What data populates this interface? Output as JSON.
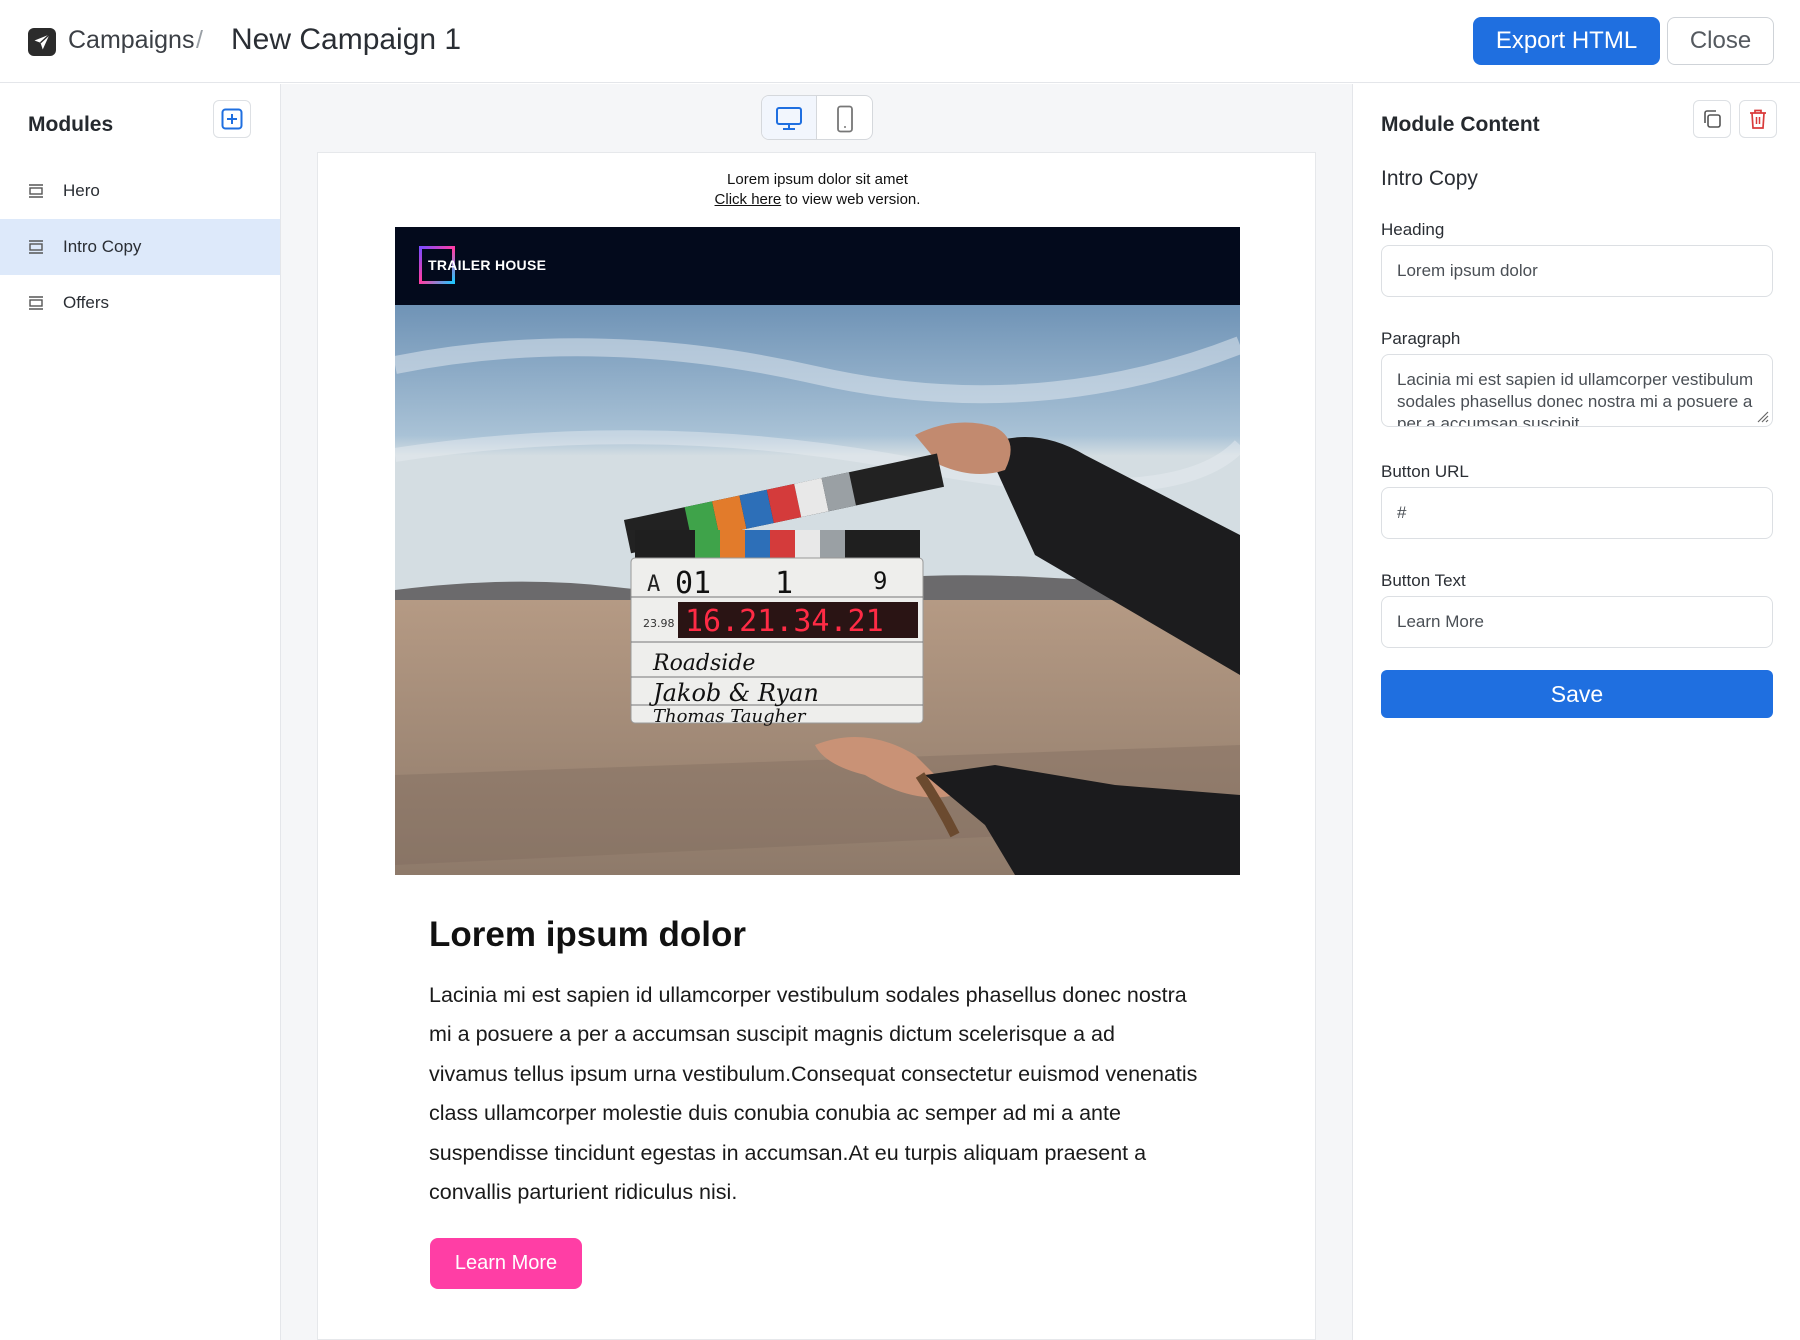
{
  "header": {
    "breadcrumb": "Campaigns",
    "separator": "/",
    "title": "New Campaign 1",
    "export_label": "Export HTML",
    "close_label": "Close"
  },
  "sidebar": {
    "title": "Modules",
    "items": [
      {
        "label": "Hero",
        "active": false
      },
      {
        "label": "Intro Copy",
        "active": true
      },
      {
        "label": "Offers",
        "active": false
      }
    ]
  },
  "email": {
    "preheader": "Lorem ipsum dolor sit amet",
    "webview_link": "Click here",
    "webview_suffix": " to view web version.",
    "brand": "TRAILER HOUSE",
    "clapper": {
      "roll": "A",
      "scene": "01",
      "shot": "1",
      "take": "9",
      "fps": "23.98",
      "timecode": "16.21.34.21",
      "production": "Roadside",
      "director": "Jakob & Ryan",
      "camera": "Thomas Taugher"
    },
    "heading": "Lorem ipsum dolor",
    "paragraph": "Lacinia mi est sapien id ullamcorper vestibulum sodales phasellus donec nostra mi a posuere a per a accumsan suscipit magnis dictum scelerisque a ad vivamus tellus ipsum urna vestibulum.Consequat consectetur euismod venenatis class ullamcorper molestie duis conubia conubia ac semper ad mi a ante suspendisse tincidunt egestas in accumsan.At eu turpis aliquam praesent a convallis parturient ridiculus nisi.",
    "button_label": "Learn More"
  },
  "panel": {
    "title": "Module Content",
    "module_name": "Intro Copy",
    "heading_label": "Heading",
    "heading_value": "Lorem ipsum dolor",
    "paragraph_label": "Paragraph",
    "paragraph_value": "Lacinia mi est sapien id ullamcorper vestibulum sodales phasellus donec nostra mi a posuere a per a accumsan suscipit",
    "url_label": "Button URL",
    "url_value": "#",
    "text_label": "Button Text",
    "text_value": "Learn More",
    "save_label": "Save"
  },
  "colors": {
    "primary": "#1f6fe0",
    "cta": "#ff3ea5",
    "active_item": "#dde9fa",
    "brand_bar": "#030a1c",
    "delete": "#d93a3a"
  },
  "icons": [
    "paper-plane-icon",
    "plus-square-icon",
    "module-icon",
    "desktop-icon",
    "mobile-icon",
    "copy-icon",
    "trash-icon"
  ]
}
